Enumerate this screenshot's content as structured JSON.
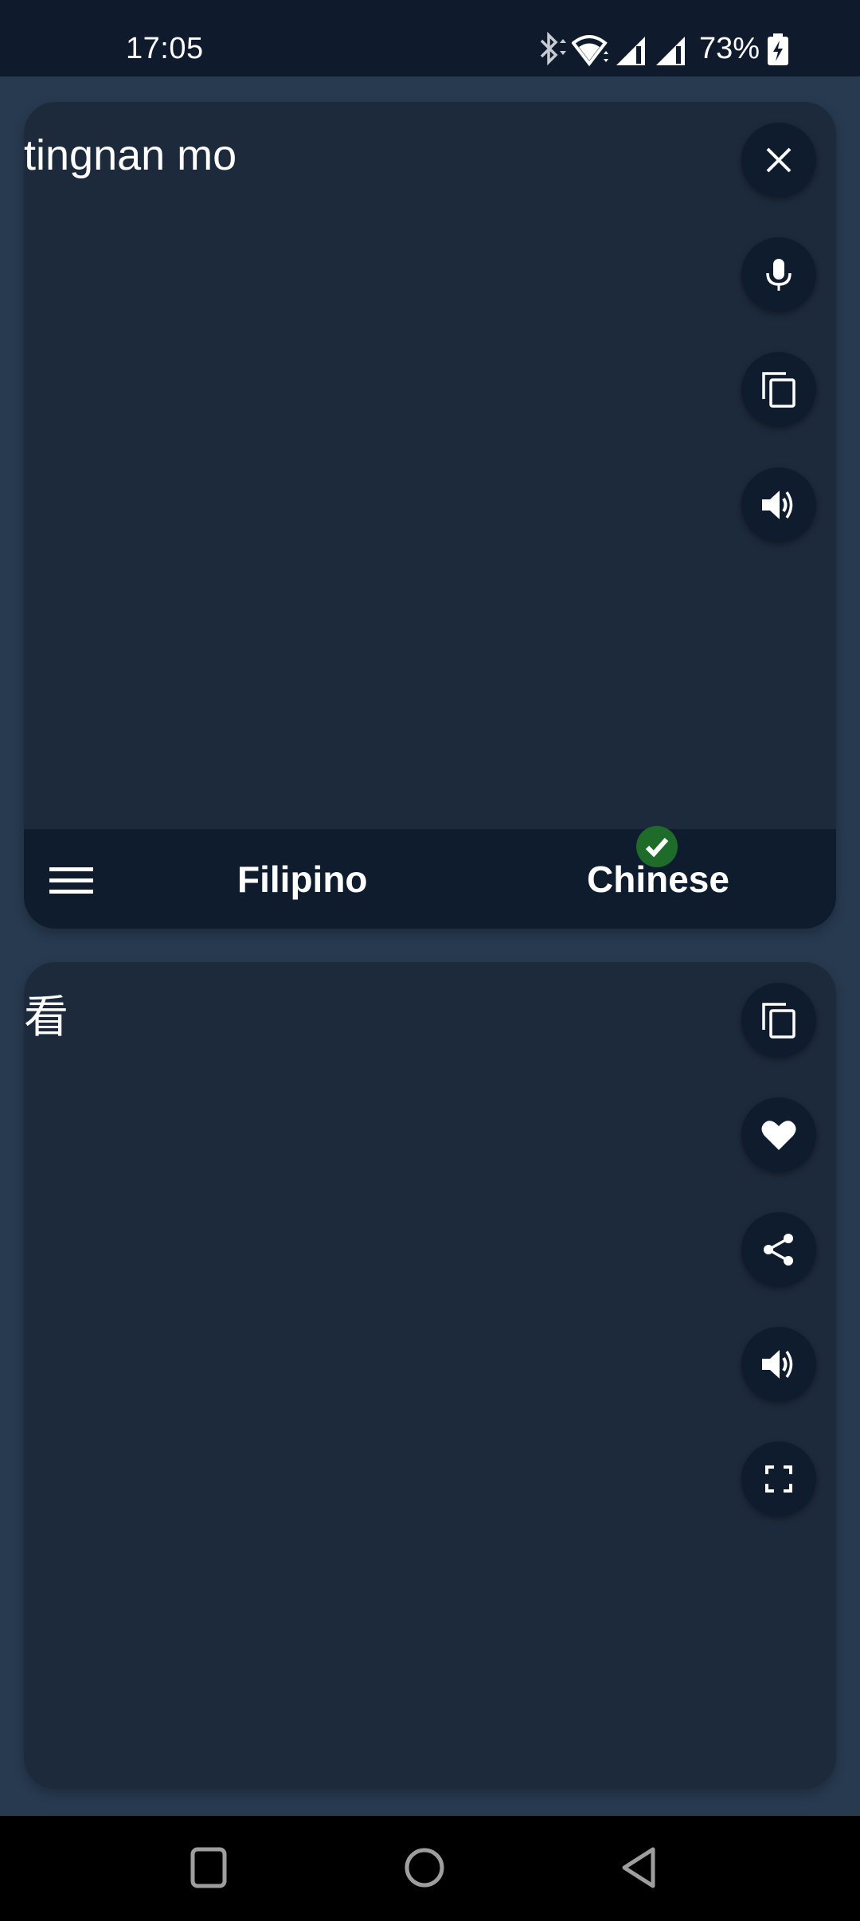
{
  "status_bar": {
    "time": "17:05",
    "battery_percent": "73%",
    "icons": [
      "bluetooth-icon",
      "wifi-icon",
      "signal-icon",
      "signal-icon",
      "battery-charging-icon"
    ]
  },
  "source_panel": {
    "input_text": "tingnan mo",
    "actions": [
      {
        "name": "clear",
        "icon": "close-icon"
      },
      {
        "name": "voice-input",
        "icon": "microphone-icon"
      },
      {
        "name": "copy",
        "icon": "copy-icon"
      },
      {
        "name": "speak",
        "icon": "speaker-icon"
      }
    ]
  },
  "language_bar": {
    "menu_icon": "hamburger-menu-icon",
    "source_language": "Filipino",
    "target_language": "Chinese",
    "target_badge_icon": "check-icon",
    "badge_color": "#1e6b2a"
  },
  "result_panel": {
    "translated_text": "看",
    "actions": [
      {
        "name": "copy",
        "icon": "copy-icon"
      },
      {
        "name": "favorite",
        "icon": "heart-icon"
      },
      {
        "name": "share",
        "icon": "share-icon"
      },
      {
        "name": "speak",
        "icon": "speaker-icon"
      },
      {
        "name": "fullscreen",
        "icon": "fullscreen-icon"
      }
    ]
  },
  "nav_bar": {
    "buttons": [
      "recents",
      "home",
      "back"
    ]
  },
  "colors": {
    "background": "#283a50",
    "card": "#1c2a3c",
    "button": "#0f1c2e",
    "status_bar": "#0f1b2d",
    "nav_icon": "#9e9e9e"
  }
}
